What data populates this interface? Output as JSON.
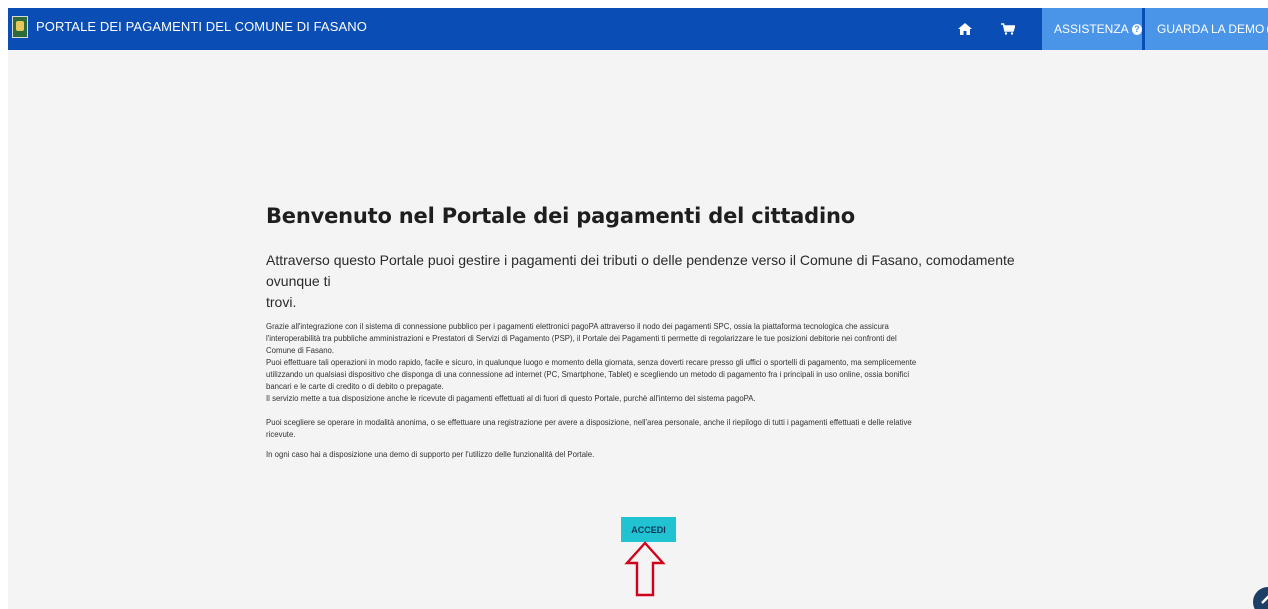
{
  "header": {
    "title": "PORTALE DEI PAGAMENTI DEL COMUNE DI FASANO",
    "assist_label": "ASSISTENZA",
    "demo_label": "GUARDA LA DEMO"
  },
  "icons": [
    "coat-of-arms-logo",
    "home-icon",
    "cart-icon",
    "info-icon",
    "arrow-up-icon",
    "scroll-top-icon"
  ],
  "colors": {
    "header_bg": "#0a4db5",
    "header_button_bg": "#4a95e8",
    "page_bg": "#f4f4f4",
    "accedi_bg": "#21c3d3",
    "arrow": "#d0021b"
  },
  "main": {
    "heading": "Benvenuto nel Portale dei pagamenti del cittadino",
    "lead_line1": "Attraverso questo Portale puoi gestire i pagamenti dei tributi o delle pendenze verso il Comune di Fasano, comodamente ovunque ti",
    "lead_line2": "trovi.",
    "para1": [
      "Grazie all'integrazione con il sistema di connessione pubblico per i pagamenti elettronici pagoPA attraverso il nodo dei pagamenti SPC, ossia la piattaforma tecnologica che assicura",
      "l'interoperabilità tra pubbliche amministrazioni e Prestatori di Servizi di Pagamento (PSP), il Portale dei Pagamenti ti permette di regolarizzare le tue posizioni debitorie nei confronti del",
      "Comune di Fasano.",
      "Puoi effettuare tali operazioni in modo rapido, facile e sicuro, in qualunque luogo e momento della giornata, senza doverti recare presso gli uffici o sportelli di pagamento, ma semplicemente",
      "utilizzando un qualsiasi dispositivo che disponga di una connessione ad internet (PC, Smartphone, Tablet) e scegliendo un metodo di pagamento fra i principali in uso online, ossia bonifici",
      "bancari e le carte di credito o di debito o prepagate.",
      "Il servizio mette a tua disposizione anche le ricevute di pagamenti effettuati al di fuori di questo Portale, purchè all'interno del sistema pagoPA."
    ],
    "para2": [
      "Puoi scegliere se operare in modalità anonima, o se effettuare una registrazione per avere a disposizione, nell'area personale, anche il riepilogo di tutti i pagamenti effettuati e delle relative",
      "ricevute."
    ],
    "para3": "In ogni caso hai a disposizione una demo di supporto per l'utilizzo delle funzionalità del Portale.",
    "accedi_label": "ACCEDI"
  }
}
